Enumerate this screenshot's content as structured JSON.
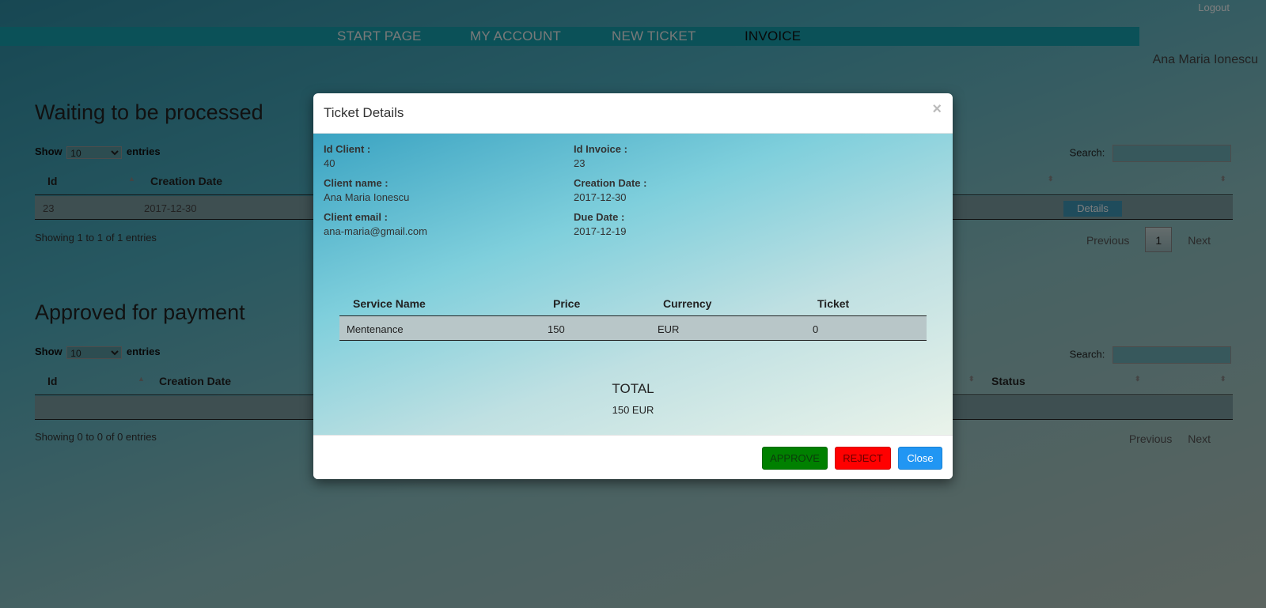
{
  "header": {
    "logout_label": "Logout",
    "nav": [
      "START PAGE",
      "MY ACCOUNT",
      "NEW TICKET",
      "INVOICE"
    ],
    "active_nav": "INVOICE",
    "user_name": "Ana Maria Ionescu"
  },
  "waiting": {
    "title": "Waiting to be processed",
    "show_label": "Show",
    "entries_value": "10",
    "entries_label": "entries",
    "search_label": "Search:",
    "columns": [
      "Id",
      "Creation Date"
    ],
    "row": {
      "id": "23",
      "date": "2017-12-30",
      "details_label": "Details"
    },
    "info": "Showing 1 to 1 of 1 entries",
    "previous_label": "Previous",
    "page": "1",
    "next_label": "Next"
  },
  "approved": {
    "title": "Approved for payment",
    "show_label": "Show",
    "entries_value": "10",
    "entries_label": "entries",
    "search_label": "Search:",
    "columns": [
      "Id",
      "Creation Date",
      "Status"
    ],
    "info": "Showing 0 to 0 of 0 entries",
    "previous_label": "Previous",
    "next_label": "Next"
  },
  "modal": {
    "title": "Ticket Details",
    "close_symbol": "×",
    "fields": {
      "id_client_label": "Id Client :",
      "id_client": "40",
      "client_name_label": "Client name :",
      "client_name": "Ana Maria Ionescu",
      "client_email_label": "Client email :",
      "client_email": "ana-maria@gmail.com",
      "id_invoice_label": "Id Invoice :",
      "id_invoice": "23",
      "creation_date_label": "Creation Date :",
      "creation_date": "2017-12-30",
      "due_date_label": "Due Date :",
      "due_date": "2017-12-19"
    },
    "table": {
      "columns": [
        "Service Name",
        "Price",
        "Currency",
        "Ticket"
      ],
      "rows": [
        {
          "service": "Mentenance",
          "price": "150",
          "currency": "EUR",
          "ticket": "0"
        }
      ]
    },
    "total_label": "TOTAL",
    "total_value": "150 EUR",
    "buttons": {
      "approve": "APPROVE",
      "reject": "REJECT",
      "close": "Close"
    }
  },
  "colors": {
    "nav_bar": "#17a2b0",
    "approve": "#008000",
    "reject": "#ff0000",
    "close": "#2196f3"
  }
}
